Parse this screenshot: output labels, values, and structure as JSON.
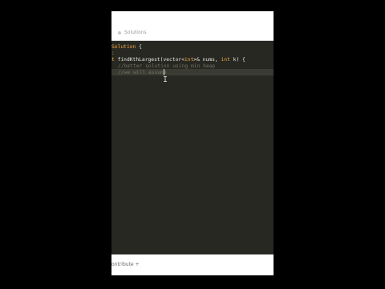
{
  "header": {
    "breadcrumb": "Solutions"
  },
  "editor": {
    "line1": {
      "kw": "Solution",
      "rest": " {"
    },
    "line2": {
      "text": ":"
    },
    "line3": {
      "kw1": "t",
      "fn": " findKthLargest(vector<",
      "ty1": "int",
      "rest": ">& nums, ",
      "ty2": "int",
      "end": " k) {"
    },
    "line4": {
      "comment": "//better solution using min heap"
    },
    "line5": {
      "comment": "//we will assume"
    }
  },
  "footer": {
    "contribute": "ontribute +"
  }
}
